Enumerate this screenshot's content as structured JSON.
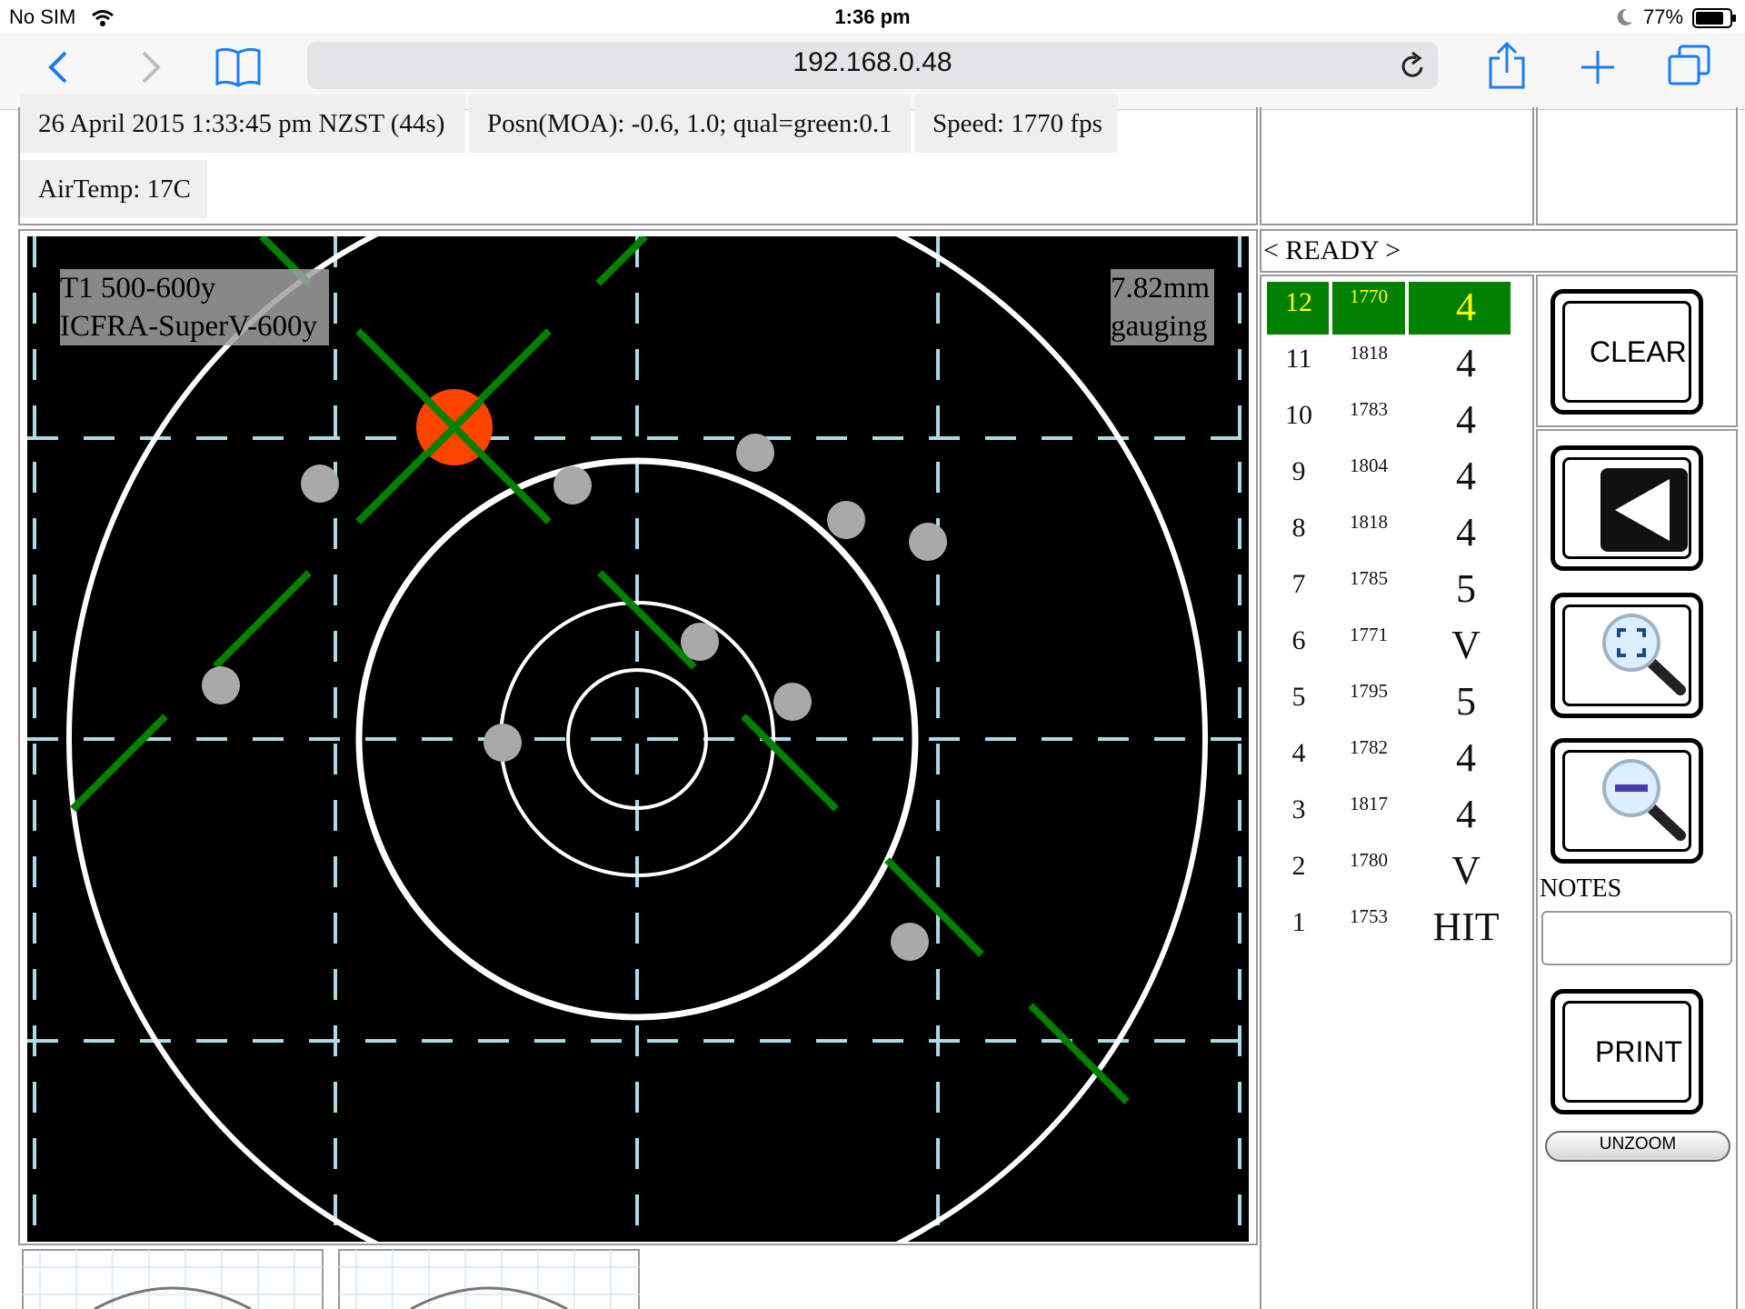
{
  "status_bar": {
    "carrier": "No SIM",
    "time": "1:36 pm",
    "battery": "77%"
  },
  "browser": {
    "url": "192.168.0.48",
    "icons": [
      "back-icon",
      "forward-icon",
      "bookmarks-icon",
      "reload-icon",
      "share-icon",
      "new-tab-icon",
      "tabs-icon"
    ]
  },
  "info": {
    "datetime": "26 April 2015 1:33:45 pm NZST (44s)",
    "position": "Posn(MOA): -0.6, 1.0; qual=green:0.1",
    "speed": "Speed: 1770 fps",
    "air_temp": "AirTemp: 17C"
  },
  "target": {
    "label_line1": "T1 500-600y",
    "label_line2": "ICFRA-SuperV-600y",
    "gauge_line1": "7.82mm",
    "gauge_line2": "gauging",
    "colors": {
      "background": "#000000",
      "ring": "#ffffff",
      "grid": "#add8e6",
      "shot": "#a9a9a9",
      "latest_shot": "#ff4400",
      "marker": "#008000"
    }
  },
  "status_message": "< READY >",
  "shots": [
    {
      "num": "12",
      "speed": "1770",
      "score": "4",
      "highlight": true
    },
    {
      "num": "11",
      "speed": "1818",
      "score": "4"
    },
    {
      "num": "10",
      "speed": "1783",
      "score": "4"
    },
    {
      "num": "9",
      "speed": "1804",
      "score": "4"
    },
    {
      "num": "8",
      "speed": "1818",
      "score": "4"
    },
    {
      "num": "7",
      "speed": "1785",
      "score": "5"
    },
    {
      "num": "6",
      "speed": "1771",
      "score": "V"
    },
    {
      "num": "5",
      "speed": "1795",
      "score": "5"
    },
    {
      "num": "4",
      "speed": "1782",
      "score": "4"
    },
    {
      "num": "3",
      "speed": "1817",
      "score": "4"
    },
    {
      "num": "2",
      "speed": "1780",
      "score": "V"
    },
    {
      "num": "1",
      "speed": "1753",
      "score": "HIT"
    }
  ],
  "controls": {
    "clear": "CLEAR",
    "notes_label": "NOTES",
    "print": "PRINT",
    "unzoom": "UNZOOM"
  }
}
